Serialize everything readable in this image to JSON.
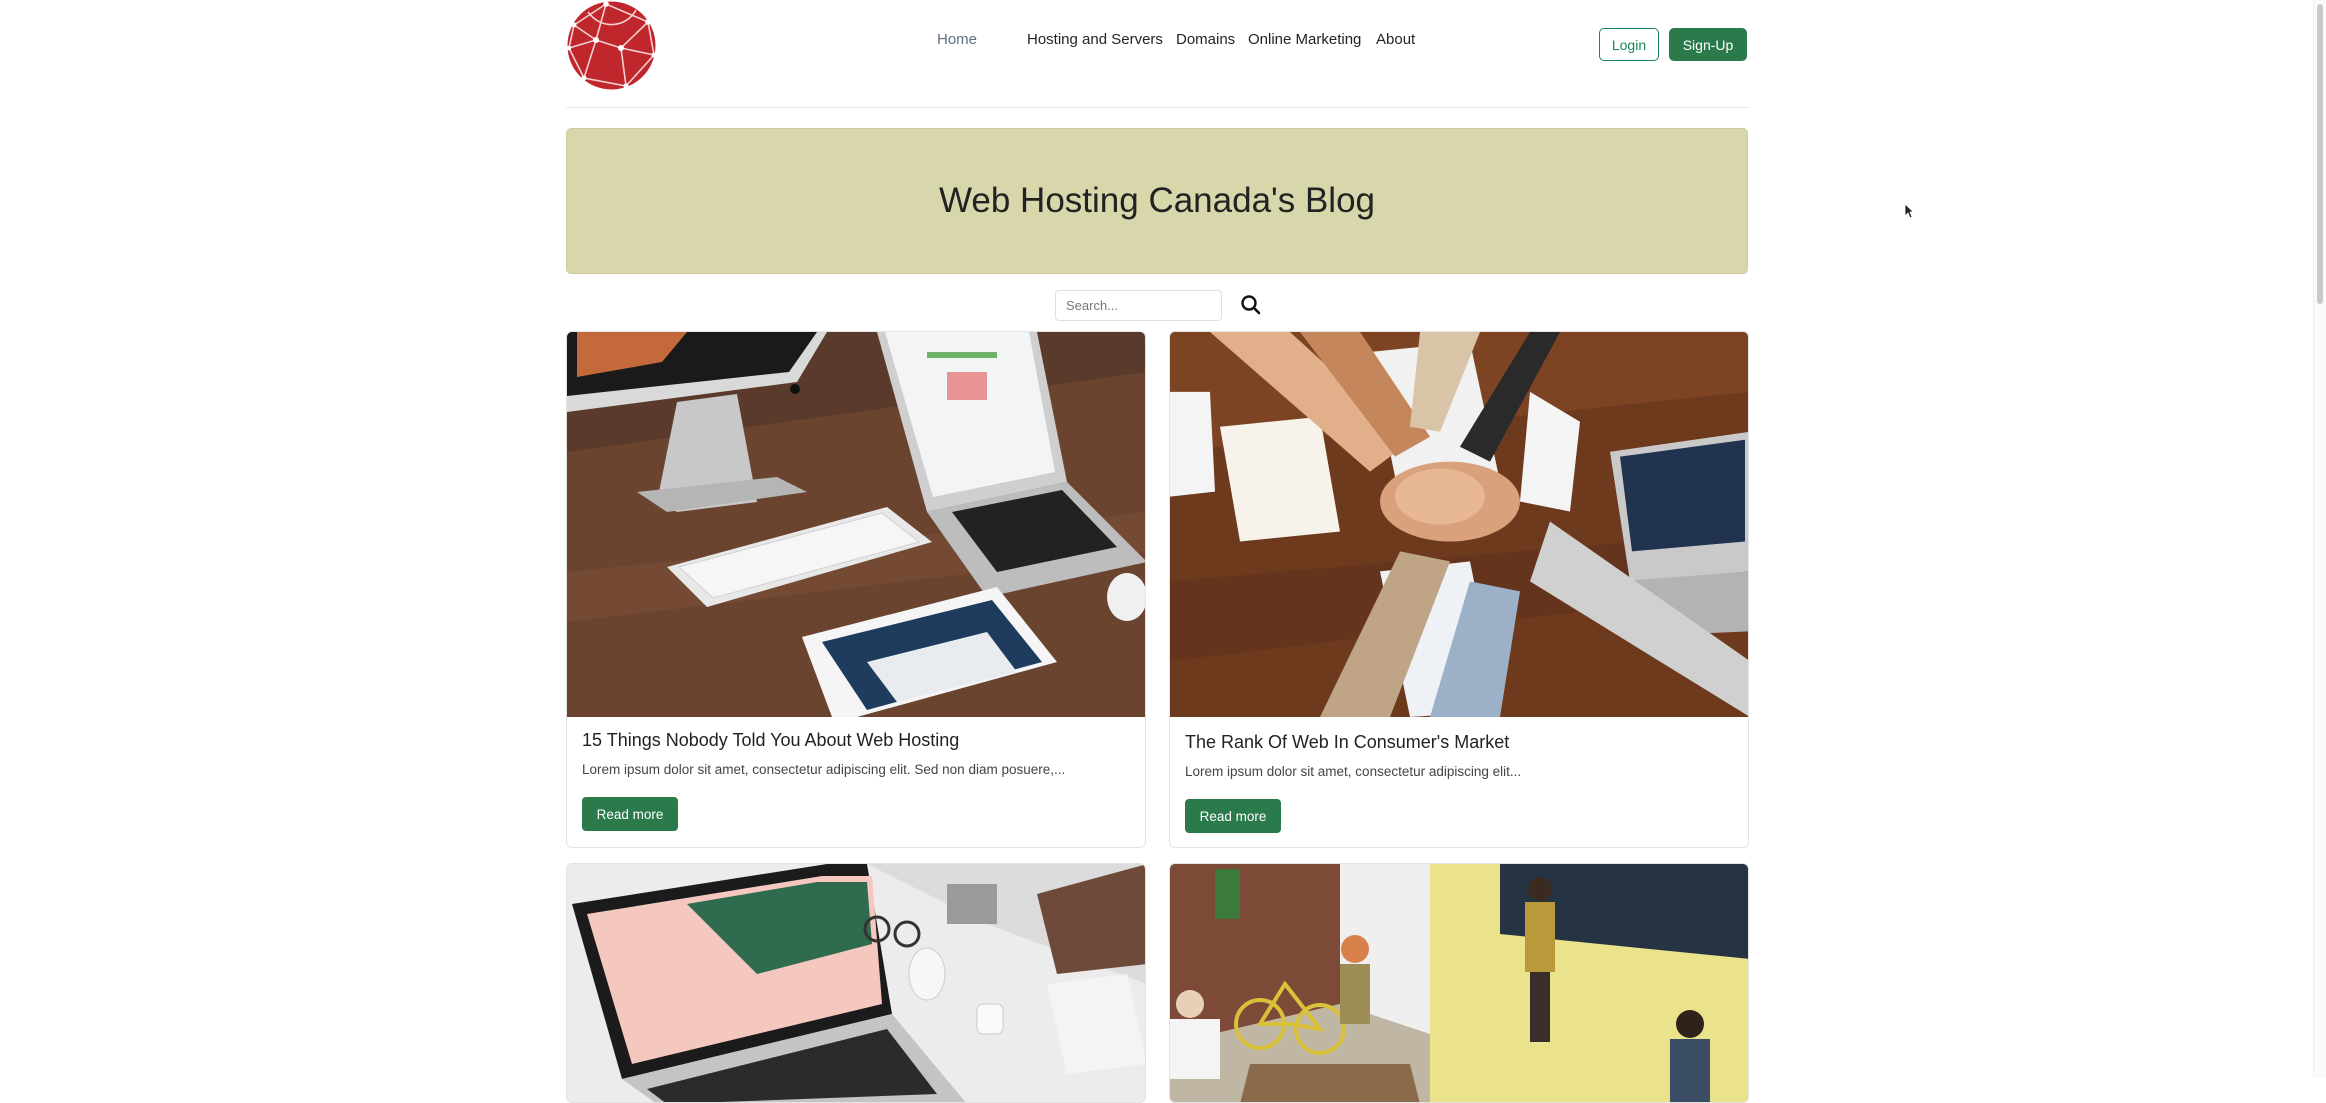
{
  "header": {
    "logo_icon": "globe-logo-icon",
    "nav": [
      {
        "label": "Home",
        "active": true
      },
      {
        "label": "Hosting and Servers",
        "active": false
      },
      {
        "label": "Domains",
        "active": false
      },
      {
        "label": "Online Marketing",
        "active": false
      },
      {
        "label": "About",
        "active": false
      }
    ],
    "login_label": "Login",
    "signup_label": "Sign-Up"
  },
  "banner": {
    "title": "Web Hosting Canada's Blog"
  },
  "search": {
    "placeholder": "Search...",
    "value": "",
    "icon": "search-icon"
  },
  "posts": [
    {
      "title": "15 Things Nobody Told You About Web Hosting",
      "excerpt": "Lorem ipsum dolor sit amet, consectetur adipiscing elit. Sed non diam posuere,...",
      "button": "Read more",
      "image": "desk-with-imac-macbook-ipad-photo"
    },
    {
      "title": "The Rank Of Web In Consumer's Market",
      "excerpt": "Lorem ipsum dolor sit amet, consectetur adipiscing elit...",
      "button": "Read more",
      "image": "team-hands-stacked-photo"
    },
    {
      "title": "",
      "excerpt": "",
      "button": "",
      "image": "laptop-on-marble-desk-photo"
    },
    {
      "title": "",
      "excerpt": "",
      "button": "",
      "image": "office-people-overhead-photo"
    }
  ],
  "colors": {
    "accent": "#2b7a4b",
    "banner_bg": "#d8d6ab",
    "logo_red": "#c0272d"
  }
}
